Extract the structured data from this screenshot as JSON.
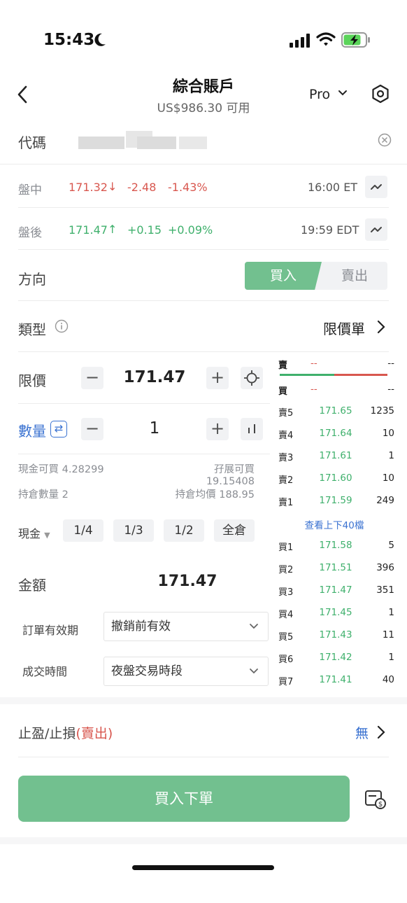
{
  "status_bar": {
    "time": "15:43"
  },
  "header": {
    "title": "綜合賬戶",
    "subtitle": "US$986.30 可用",
    "mode": "Pro"
  },
  "code": {
    "label": "代碼"
  },
  "quotes": [
    {
      "label": "盤中",
      "price": "171.32",
      "arrow": "↓",
      "change": "-2.48",
      "percent": "-1.43%",
      "time": "16:00 ET",
      "trend": "down"
    },
    {
      "label": "盤後",
      "price": "171.47",
      "arrow": "↑",
      "change": "+0.15",
      "percent": "+0.09%",
      "time": "19:59 EDT",
      "trend": "up"
    }
  ],
  "direction": {
    "label": "方向",
    "buy": "買入",
    "sell": "賣出",
    "selected": "buy"
  },
  "order_type": {
    "label": "類型",
    "value": "限價單"
  },
  "limit_price": {
    "label": "限價",
    "value": "171.47"
  },
  "quantity": {
    "label": "數量",
    "value": "1",
    "swap_glyph": "⇄"
  },
  "info": {
    "cash_buyable": "現金可買 4.28299",
    "margin_buyable": "孖展可買 19.15408",
    "position_qty": "持倉數量 2",
    "avg_cost": "持倉均價 188.95"
  },
  "fractions": {
    "account_label": "現金",
    "options": [
      "1/4",
      "1/3",
      "1/2",
      "全倉"
    ]
  },
  "amount": {
    "label": "金額",
    "value": "171.47"
  },
  "validity": {
    "label": "訂單有效期",
    "value": "撤銷前有效"
  },
  "session": {
    "label": "成交時間",
    "value": "夜盤交易時段"
  },
  "order_book": {
    "top": [
      {
        "label": "賣",
        "price": "--",
        "qty": "--"
      },
      {
        "label": "買",
        "price": "--",
        "qty": "--"
      }
    ],
    "asks": [
      {
        "label": "賣5",
        "price": "171.65",
        "qty": "1235"
      },
      {
        "label": "賣4",
        "price": "171.64",
        "qty": "10"
      },
      {
        "label": "賣3",
        "price": "171.61",
        "qty": "1"
      },
      {
        "label": "賣2",
        "price": "171.60",
        "qty": "10"
      },
      {
        "label": "賣1",
        "price": "171.59",
        "qty": "249"
      }
    ],
    "more_label": "查看上下40檔",
    "bids": [
      {
        "label": "買1",
        "price": "171.58",
        "qty": "5"
      },
      {
        "label": "買2",
        "price": "171.51",
        "qty": "396"
      },
      {
        "label": "買3",
        "price": "171.47",
        "qty": "351"
      },
      {
        "label": "買4",
        "price": "171.45",
        "qty": "1"
      },
      {
        "label": "買5",
        "price": "171.43",
        "qty": "11"
      },
      {
        "label": "買6",
        "price": "171.42",
        "qty": "1"
      },
      {
        "label": "買7",
        "price": "171.41",
        "qty": "40"
      }
    ]
  },
  "take_profit": {
    "label": "止盈/止損",
    "side": "(賣出)",
    "value": "無"
  },
  "submit": {
    "label": "買入下單"
  },
  "colors": {
    "up": "#3fb06c",
    "down": "#d8574f",
    "buy_button": "#72c08f",
    "link": "#3a72d1"
  },
  "icons": [
    "moon-icon",
    "signal-icon",
    "wifi-icon",
    "battery-charging-icon",
    "back-arrow-icon",
    "chevron-down-icon",
    "settings-icon",
    "clear-icon",
    "chart-icon",
    "info-icon",
    "chevron-right-icon",
    "minus-icon",
    "plus-icon",
    "crosshair-icon",
    "depth-icon",
    "swap-icon",
    "fee-icon"
  ]
}
